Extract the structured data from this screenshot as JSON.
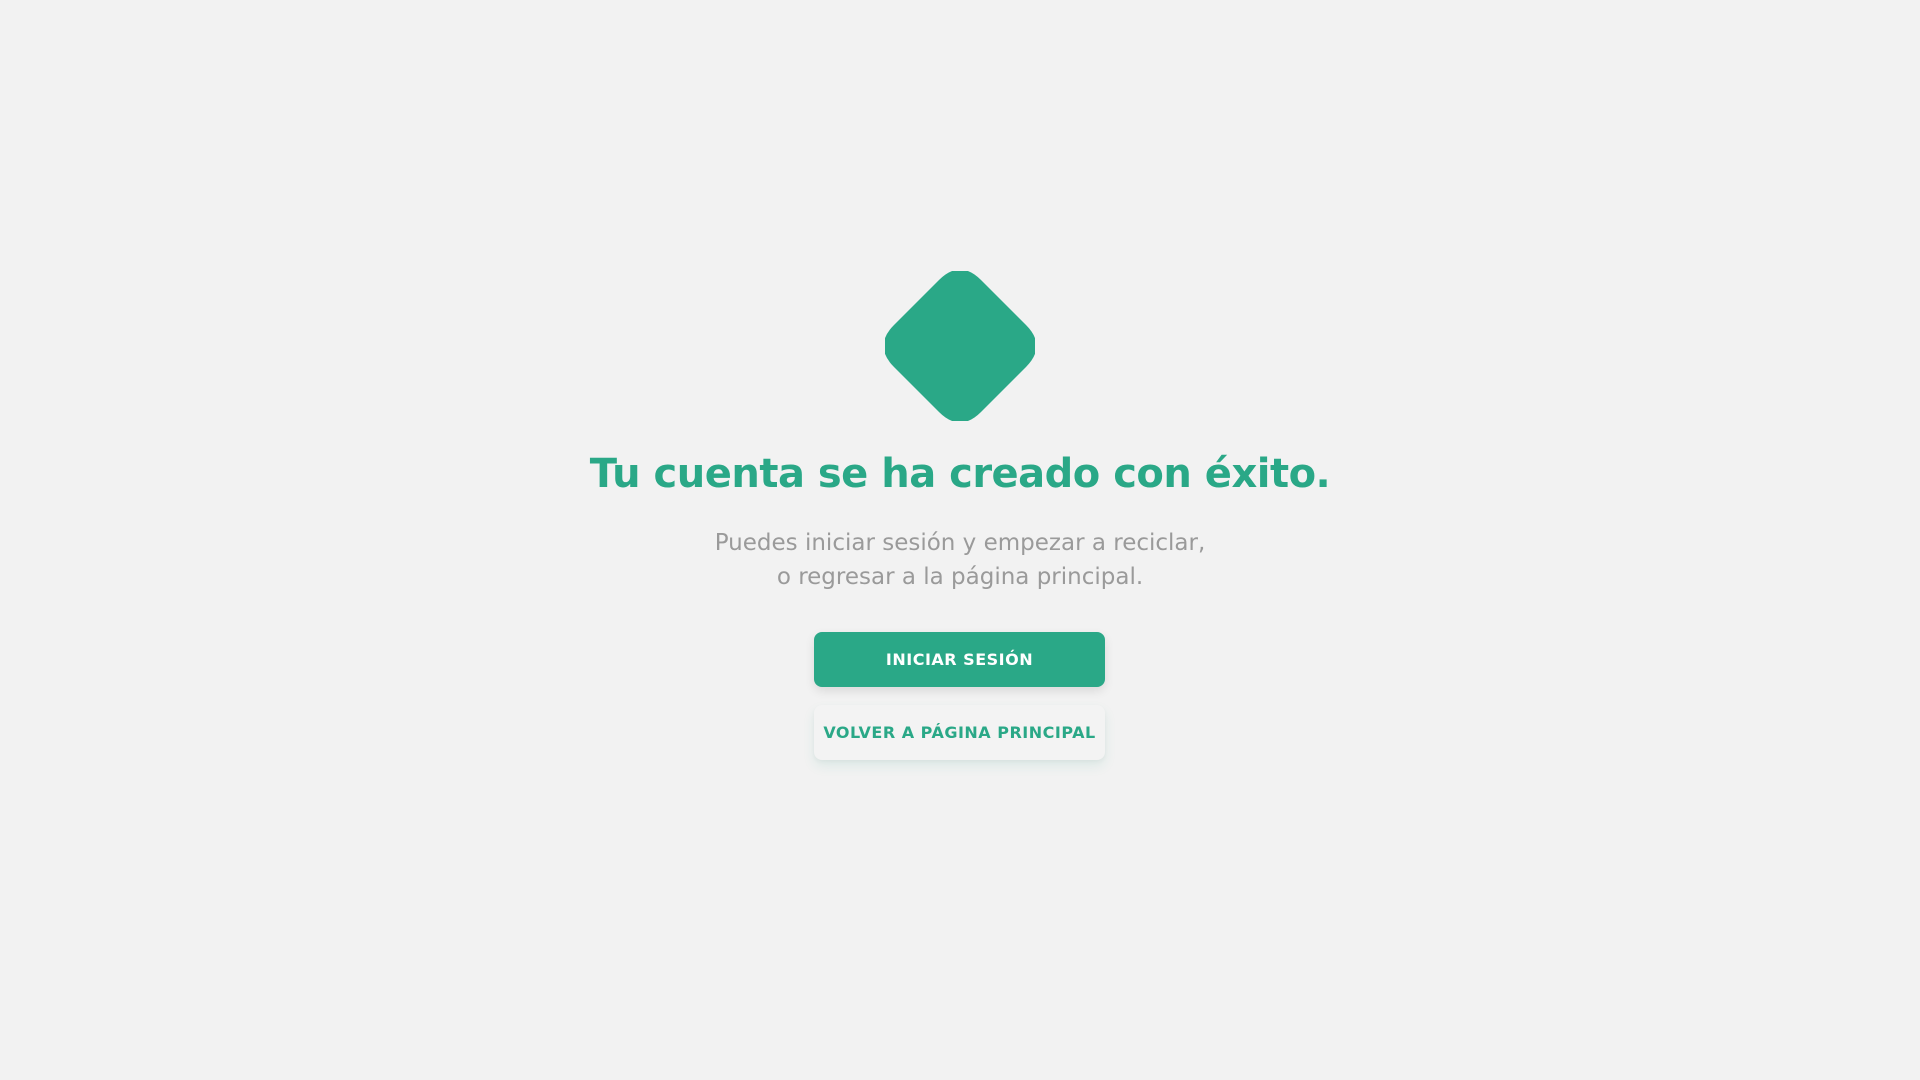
{
  "colors": {
    "accent": "#2aa887",
    "background": "#f2f2f2",
    "subtitle": "#9a9a9a",
    "secondary_button_bg": "#f3f3f3"
  },
  "logo": {
    "icon": "rounded-diamond-logo-icon"
  },
  "title": "Tu cuenta se ha creado con éxito.",
  "subtitle": {
    "line1": "Puedes iniciar sesión y empezar a reciclar,",
    "line2": "o regresar a la página principal."
  },
  "buttons": {
    "login": "INICIAR SESIÓN",
    "home": "VOLVER A PÁGINA PRINCIPAL"
  }
}
